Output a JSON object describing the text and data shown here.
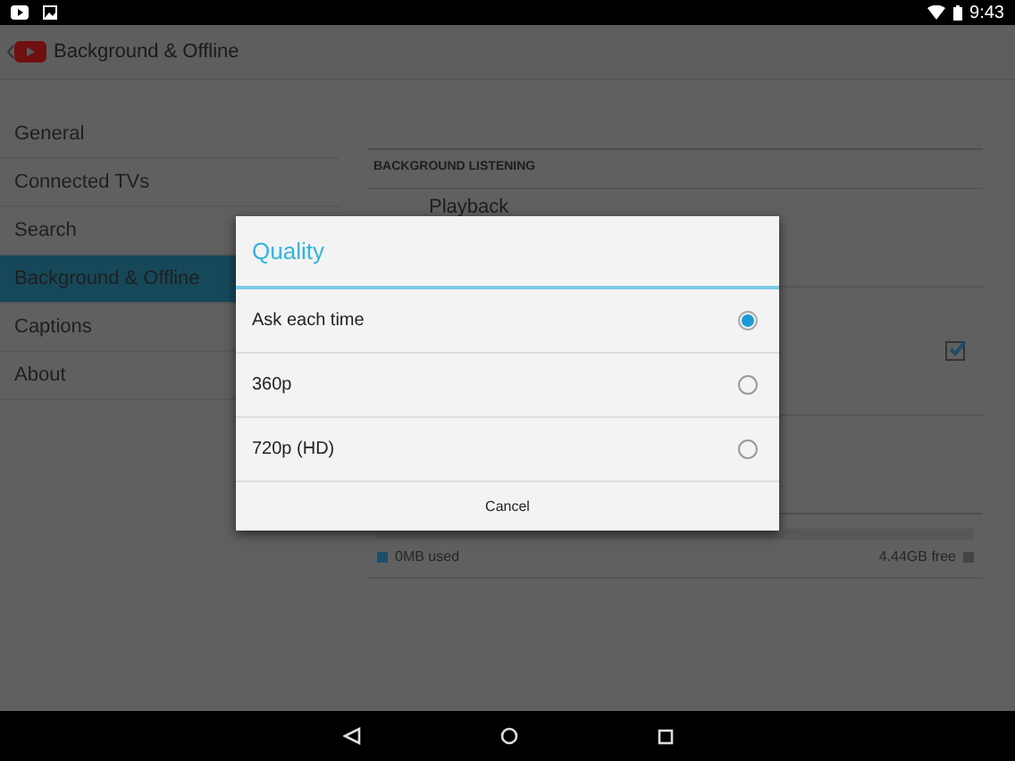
{
  "status_bar": {
    "time": "9:43"
  },
  "action_bar": {
    "title": "Background & Offline"
  },
  "sidebar": {
    "items": [
      {
        "label": "General",
        "selected": false
      },
      {
        "label": "Connected TVs",
        "selected": false
      },
      {
        "label": "Search",
        "selected": false
      },
      {
        "label": "Background & Offline",
        "selected": true
      },
      {
        "label": "Captions",
        "selected": false
      },
      {
        "label": "About",
        "selected": false
      }
    ]
  },
  "settings": {
    "section_header": "BACKGROUND LISTENING",
    "playback_label": "Playback",
    "offline_checkbox": {
      "checked": true
    },
    "storage": {
      "used": "0MB used",
      "free": "4.44GB free"
    }
  },
  "dialog": {
    "title": "Quality",
    "options": [
      {
        "label": "Ask each time",
        "selected": true
      },
      {
        "label": "360p",
        "selected": false
      },
      {
        "label": "720p (HD)",
        "selected": false
      }
    ],
    "cancel": "Cancel"
  }
}
